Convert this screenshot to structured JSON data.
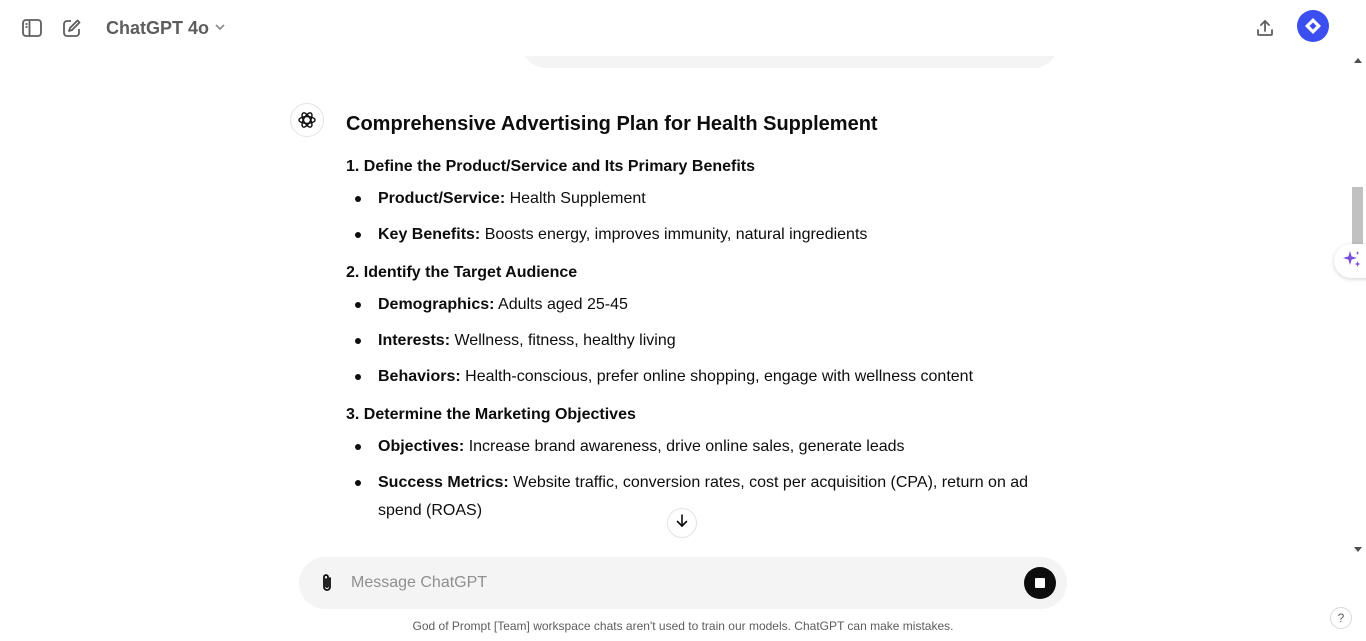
{
  "header": {
    "model_label": "ChatGPT 4o"
  },
  "icons": {
    "sidebar_toggle": "sidebar-toggle-icon",
    "new_chat": "pencil-square-icon",
    "model_chevron": "chevron-down-icon",
    "share": "share-upload-icon",
    "assistant": "openai-logo-icon",
    "sparkle": "sparkle-icon",
    "scroll_down": "arrow-down-icon",
    "attach": "paperclip-icon",
    "stop": "stop-square-icon"
  },
  "colors": {
    "avatar_bg": "#3b4ef0",
    "composer_bg": "#f4f4f4",
    "sparkle": "#7b4fd6"
  },
  "message": {
    "title": "Comprehensive Advertising Plan for Health Supplement",
    "sections": [
      {
        "heading": "1. Define the Product/Service and Its Primary Benefits",
        "items": [
          {
            "label": "Product/Service:",
            "text": " Health Supplement"
          },
          {
            "label": "Key Benefits:",
            "text": " Boosts energy, improves immunity, natural ingredients"
          }
        ]
      },
      {
        "heading": "2. Identify the Target Audience",
        "items": [
          {
            "label": "Demographics:",
            "text": " Adults aged 25-45"
          },
          {
            "label": "Interests:",
            "text": " Wellness, fitness, healthy living"
          },
          {
            "label": "Behaviors:",
            "text": " Health-conscious, prefer online shopping, engage with wellness content"
          }
        ]
      },
      {
        "heading": "3. Determine the Marketing Objectives",
        "items": [
          {
            "label": "Objectives:",
            "text": " Increase brand awareness, drive online sales, generate leads"
          },
          {
            "label": "Success Metrics:",
            "text": " Website traffic, conversion rates, cost per acquisition (CPA), return on ad spend (ROAS)"
          }
        ]
      }
    ]
  },
  "composer": {
    "placeholder": "Message ChatGPT"
  },
  "footer": {
    "note": "God of Prompt [Team] workspace chats aren't used to train our models. ChatGPT can make mistakes.",
    "help_label": "?"
  }
}
